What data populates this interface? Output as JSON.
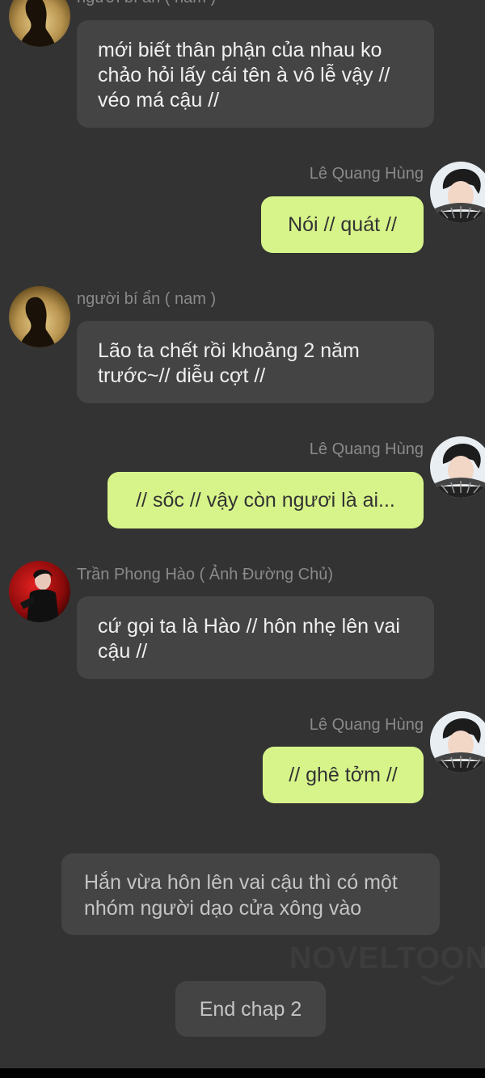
{
  "colors": {
    "background": "#333333",
    "left_bubble": "#444444",
    "right_bubble": "#d7f48a",
    "name_text": "#8a8a8a"
  },
  "messages": [
    {
      "side": "left",
      "avatar": "silhouette-avatar",
      "name": "người bí ẩn ( nam )",
      "text": "mới biết thân phận của  nhau ko chảo hỏi lấy cái tên à vô lễ vậy // véo má cậu //"
    },
    {
      "side": "right",
      "avatar": "le-quang-hung-avatar",
      "name": "Lê Quang Hùng",
      "text": "Nói // quát //"
    },
    {
      "side": "left",
      "avatar": "silhouette-avatar",
      "name": "người bí ẩn ( nam )",
      "text": "Lão ta chết rồi khoảng 2 năm trước~// diễu cợt //"
    },
    {
      "side": "right",
      "avatar": "le-quang-hung-avatar",
      "name": "Lê Quang Hùng",
      "text": "// sốc // vậy còn ngươi là ai..."
    },
    {
      "side": "left",
      "avatar": "tran-phong-hao-avatar",
      "name": "Trần Phong Hào ( Ảnh Đường Chủ)",
      "text": "cứ gọi ta là Hào // hôn nhẹ lên vai cậu //"
    },
    {
      "side": "right",
      "avatar": "le-quang-hung-avatar",
      "name": "Lê Quang Hùng",
      "text": "// ghê tởm //"
    }
  ],
  "narration": "Hắn vừa hôn lên vai cậu thì có một nhóm người dạo cửa xông vào",
  "end_label": "End chap 2",
  "watermark": "NOVELTOON"
}
